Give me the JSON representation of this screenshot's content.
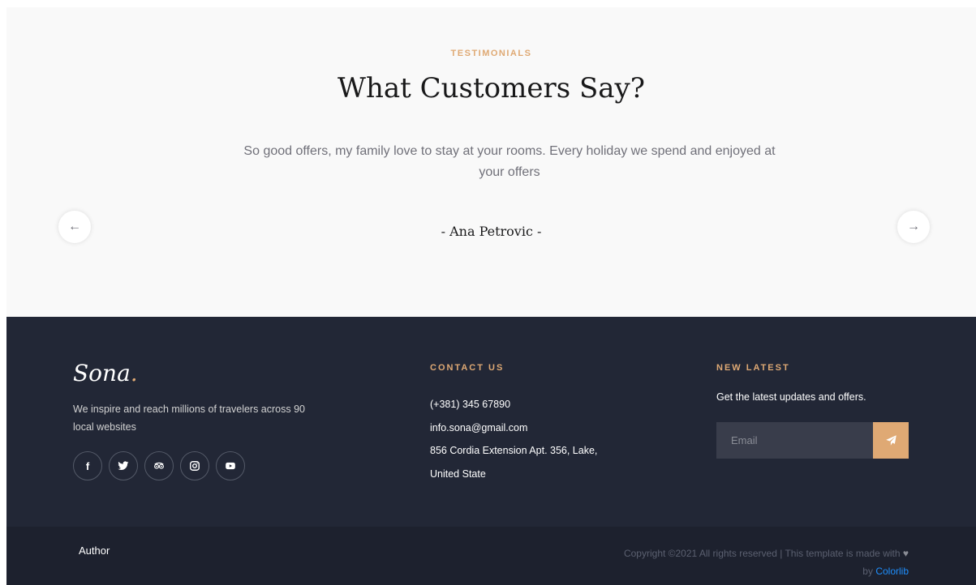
{
  "testimonials": {
    "tag": "TESTIMONIALS",
    "title": "What Customers Say?",
    "quote": "So good offers, my family love to stay at your rooms. Every holiday we spend and enjoyed at your offers",
    "author": "- Ana Petrovic -",
    "prev_icon": "←",
    "next_icon": "→"
  },
  "footer": {
    "logo_text": "Sona",
    "logo_dot": ".",
    "about": "We inspire and reach millions of travelers across 90 local websites",
    "socials": [
      {
        "name": "facebook-icon",
        "glyph": "f"
      },
      {
        "name": "twitter-icon",
        "glyph": "twitter"
      },
      {
        "name": "tripadvisor-icon",
        "glyph": "tripadvisor"
      },
      {
        "name": "instagram-icon",
        "glyph": "instagram"
      },
      {
        "name": "youtube-icon",
        "glyph": "youtube"
      }
    ],
    "contact": {
      "title": "CONTACT US",
      "phone": "(+381) 345 67890",
      "email": "info.sona@gmail.com",
      "address_line1": "856 Cordia Extension Apt. 356, Lake,",
      "address_line2": "United State"
    },
    "newsletter": {
      "title": "NEW LATEST",
      "text": "Get the latest updates and offers.",
      "placeholder": "Email",
      "send_icon": "paper-plane-icon"
    }
  },
  "bottom": {
    "author_link": "Author",
    "copyright": "Copyright ©2021 All rights reserved | This template is made with",
    "heart": "♥",
    "by": "by",
    "colorlib": "Colorlib"
  },
  "colors": {
    "accent": "#dfa974",
    "footer_bg": "#222736",
    "link_blue": "#1e90ff"
  }
}
